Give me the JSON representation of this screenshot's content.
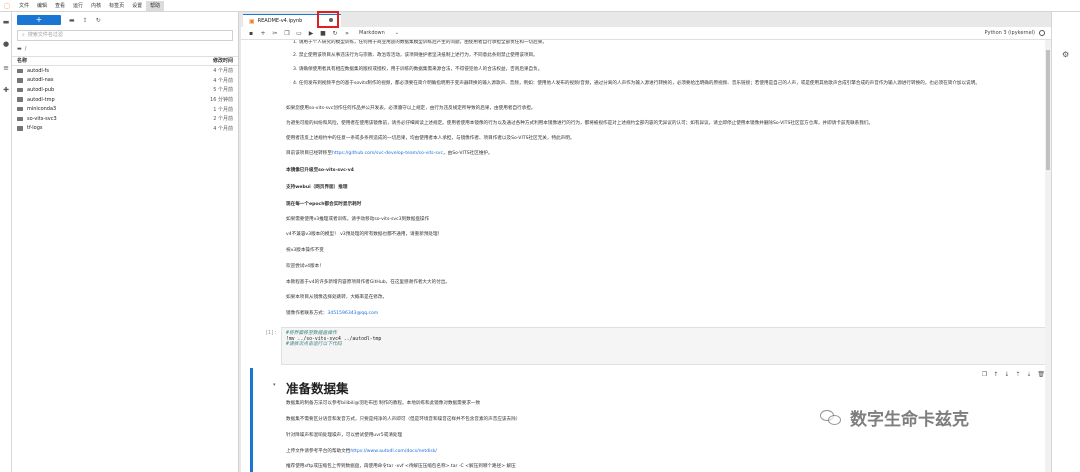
{
  "menu": {
    "items": [
      "文件",
      "编辑",
      "查看",
      "运行",
      "内核",
      "标签页",
      "设置",
      "帮助"
    ],
    "active_index": 7
  },
  "sidebar": {
    "new_button_label": "+",
    "search_placeholder": "搜索文件名过滤",
    "path": "/",
    "col_name": "名称",
    "col_modified": "修改时间",
    "files": [
      {
        "name": "autodl-fs",
        "modified": "4 个月前"
      },
      {
        "name": "autodl-nas",
        "modified": "4 个月前"
      },
      {
        "name": "autodl-pub",
        "modified": "5 个月前"
      },
      {
        "name": "autodl-tmp",
        "modified": "16 分钟前"
      },
      {
        "name": "miniconda3",
        "modified": "1 个月前"
      },
      {
        "name": "so-vits-svc3",
        "modified": "2 个月前"
      },
      {
        "name": "tf-logs",
        "modified": "4 个月前"
      }
    ]
  },
  "tab": {
    "title": "README-v4.ipynb"
  },
  "notebook_toolbar": {
    "cell_type": "Markdown",
    "kernel": "Python 3 (ipykernel)"
  },
  "markdown": {
    "list_items": [
      "1. 请用于个人研究的模型训练，任何用于商业用途的数据集模型训练后产生的问题，由使用者自行承担全部责任和一切后果。",
      "2. 禁止使用该项目从事违法行为与宗教、政治等活动，该项目维护者坚决抵制上述行为，不同意此条则禁止使用该项目。",
      "3. 请确保使用者具有相应数据集的版权或授权，用于训练的数据集需来源合法，不得侵犯他人的合法权益，否则后果自负。",
      "4. 任何发布到视频平台的基于sovits制作的视频，都必须要在简介明确指明用于变声器转换的输入源歌声、音频，例如：使用他人发布的视频/音频，通过分离的人声作为输入源进行转换的，必须要给出明确的原视频、音乐链接；若使用是自己的人声，或是使用其他歌声合成引擎合成的声音作为输入源进行转换的，也必须在简介加以说明。"
    ],
    "paragraphs": [
      "如果您使用so-vits-svc创作任何作品并公开发表，必须遵守以上规定，由行为违反规定所导致的后果，由使用者自行承担。",
      "为避免可能的纠纷和风险，使用者在使用该镜像前，请务必仔细阅读上述规定。使用者使用本镜像的行为以及通过各种方式利用本镜像进行的行为，都将被视作是对上述规约全部内容的无异议的认可；如有异议，请立即停止使用本镜像并删除So-VITS社区官方仓库，并即请卡兹克联系我们。",
      "使用者违反上述规约中的任意一条或多条所造成的一切后果，均由使用者本人承担，与镜像作者、项目作者以及So-VITS社区无关，特此声明。"
    ],
    "repo_prefix": "目前该项目已经转移至",
    "repo_link": "https://github.com/svc-develop-team/so-vits-svc",
    "repo_suffix": "，由So-VITS社区维护。",
    "bold_1": "本镜像已升级至so-vits-svc-v4",
    "bold_2": "支持webui（网页界面）推理",
    "bold_3": "现在每一个epoch都会实时显示耗时",
    "lines": [
      "如果需要使用v3推理或者训练，请手动移动so-vits-svc3到数据盘操作",
      "v4不兼容v3版本的模型！ v3预处理的所有数据也都不通用，请重新预处理！",
      "祝v3版本操作不变",
      "欢迎尝试v4版本！",
      "本教程基于v4的许多新增内容原项目作者GitHub，在这里感谢作者大大的付出。",
      "如果本项目从镜像选择处跳转，大概率是在修改。"
    ],
    "contact_prefix": "镜像作者联系方式：",
    "contact_email": "3451596343@qq.com"
  },
  "code_cell": {
    "prompt": "[1]:",
    "lines": [
      "#将界面移至数据盘操作",
      "!mv ../so-vits-svc4 ../autodl-tmp",
      "#请依次点击运行以下代码"
    ]
  },
  "active_cell": {
    "heading": "准备数据集",
    "lines": [
      "数据集的制备方法可以参考bilibili@羽毛布团 制作的教程。本地训练和此镜像对数据需要求一致",
      "数据集不需要区分语音和发音方式，只要是纯净的人声即可（但是环境音和噪音这样并不包含音素的声音应该去除）",
      "针对降噪声和混响处理噪声，可以尝试使用uvr5或清处理",
      "上传文件请参考平台的帮助文档",
      "推荐使用xftp或压缩包上传到数据盘，再使用命令tar -xvf <待解压压缩包名称>.tar -C <解压到哪个路径> 解压",
      "如果操作反复出现文件不存在的报错，请自行学习Linux的cd cp等常用命令的操作，本镜像处理好，不建议小白更改文件"
    ],
    "help_link": "https://www.autodl.com/docs/netdisk/"
  },
  "watermark": {
    "text": "数字生命卡兹克"
  }
}
